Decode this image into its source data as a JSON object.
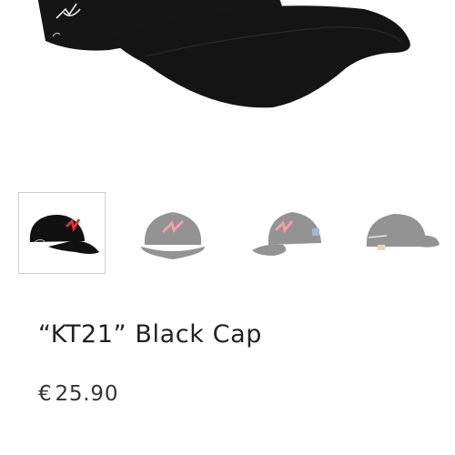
{
  "product": {
    "title": "“KT21” Black Cap",
    "currency": "€",
    "price": "25.90"
  },
  "gallery": {
    "selected_index": 0,
    "thumbnails": [
      {
        "view": "side-left",
        "selected": true
      },
      {
        "view": "front",
        "selected": false
      },
      {
        "view": "front-angled",
        "selected": false
      },
      {
        "view": "back",
        "selected": false
      }
    ]
  },
  "colors": {
    "cap": "#121212",
    "logo_red": "#e0303a",
    "thumb_border": "#cfcfcf",
    "text": "#222222"
  }
}
